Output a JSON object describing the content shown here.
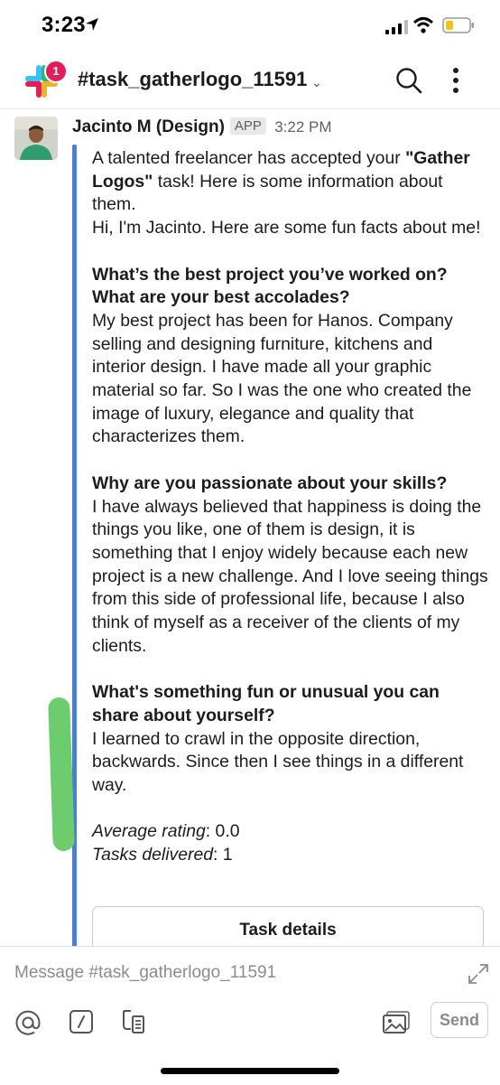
{
  "status": {
    "time": "3:23"
  },
  "header": {
    "channel": "#task_gatherlogo_11591",
    "unread_count": "1"
  },
  "message": {
    "author": "Jacinto M (Design)",
    "app_tag": "APP",
    "time": "3:22 PM",
    "intro_1": "A talented freelancer has accepted your ",
    "intro_task": "\"Gather Logos\"",
    "intro_2": " task! Here is some information about them.",
    "intro_3": "Hi, I'm Jacinto. Here are some fun facts about me!",
    "q1": "What’s the best project you’ve worked on? What are your best accolades?",
    "a1": "My best project has been for Hanos. Company selling and designing furniture, kitchens and interior design. I have made all your graphic material so far. So I was the one who created the image of luxury, elegance and quality that characterizes them.",
    "q2": "Why are you passionate about your skills?",
    "a2": "I have always believed that happiness is doing the things you like, one of them is design, it is something that I enjoy widely because each new project is a new challenge. And I love seeing things from this side of professional life, because I also think of myself as a receiver of the clients of my clients.",
    "q3": "What's something fun or unusual you can share about yourself?",
    "a3": "I learned to crawl in the opposite direction, backwards. Since then I see things in a different way.",
    "rating_label": "Average rating",
    "rating_value": ": 0.0",
    "tasks_label": "Tasks delivered",
    "tasks_value": ": 1",
    "button": "Task details"
  },
  "composer": {
    "placeholder": "Message #task_gatherlogo_11591",
    "send": "Send"
  },
  "icons": [
    "location-arrow-icon",
    "signal-icon",
    "wifi-icon",
    "battery-icon",
    "slack-logo-icon",
    "chevron-down-icon",
    "search-icon",
    "more-vertical-icon",
    "expand-icon",
    "mention-icon",
    "slash-command-icon",
    "format-icon",
    "image-icon"
  ],
  "colors": {
    "accent_bar": "#4a7fd6",
    "badge": "#e01e5a",
    "highlight": "#6dcc6d"
  }
}
